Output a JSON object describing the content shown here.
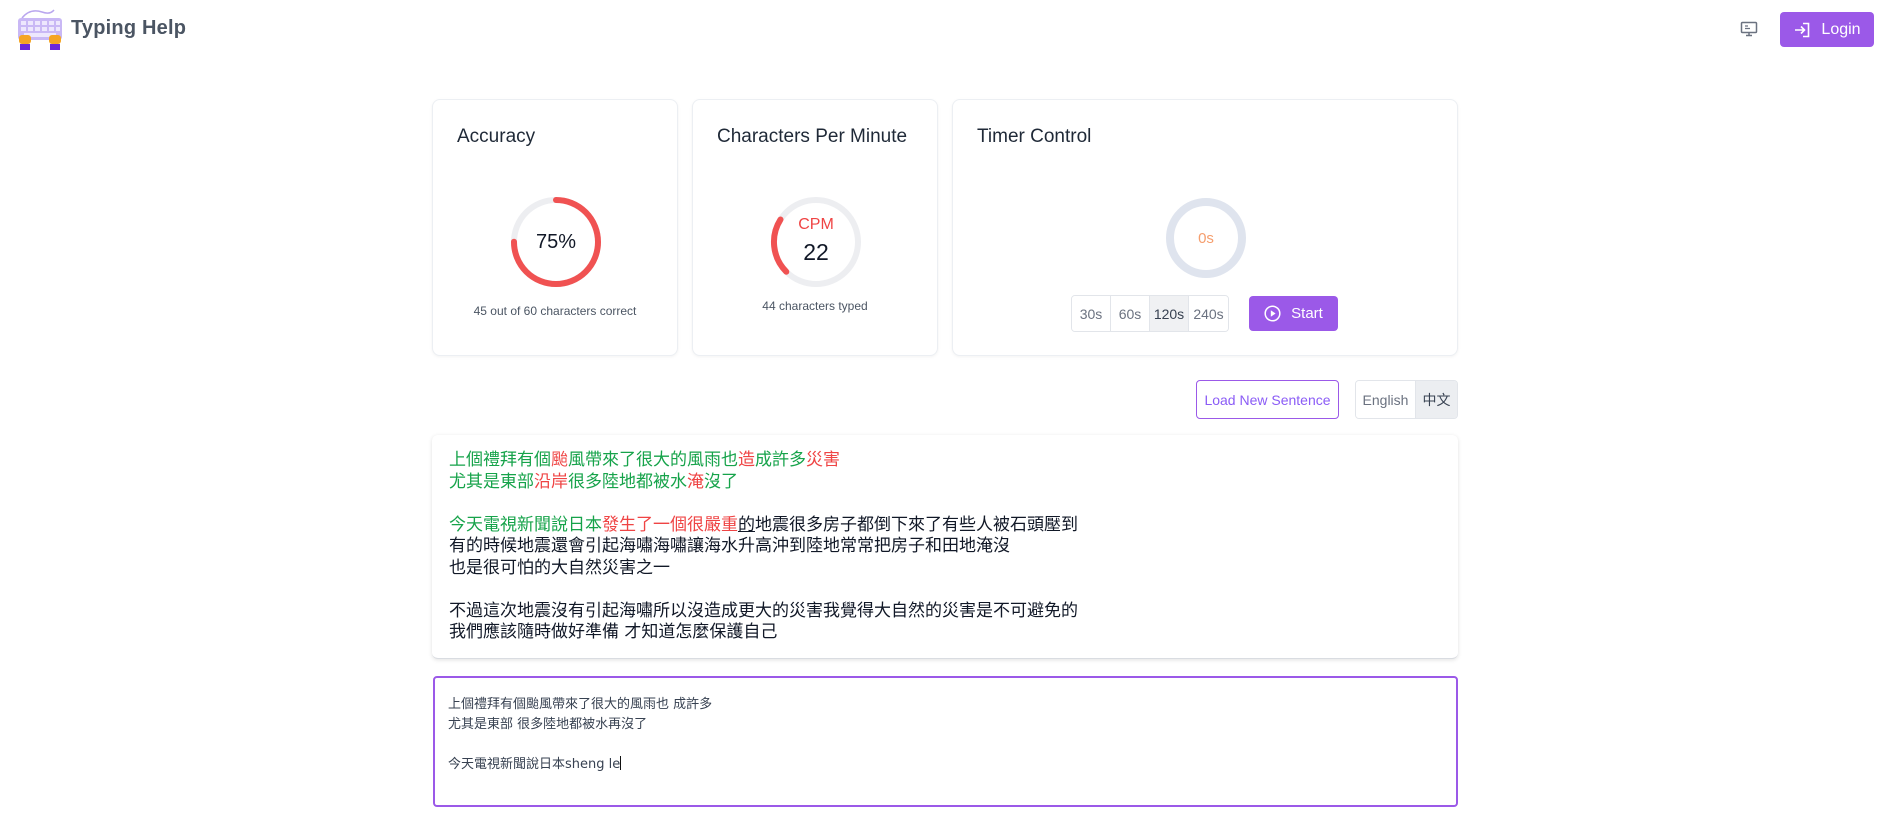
{
  "header": {
    "brand": "Typing Help",
    "login_label": "Login"
  },
  "colors": {
    "accent": "#9b59e8",
    "correct": "#16a34a",
    "incorrect": "#ef4444",
    "timer": "#f59e6e"
  },
  "accuracy": {
    "title": "Accuracy",
    "value": "75%",
    "percent": 75,
    "summary": "45 out of 60 characters correct"
  },
  "cpm": {
    "title": "Characters Per Minute",
    "label": "CPM",
    "value": "22",
    "summary": "44 characters typed"
  },
  "timer": {
    "title": "Timer Control",
    "value": "0s",
    "durations": [
      "30s",
      "60s",
      "120s",
      "240s"
    ],
    "selected": "120s",
    "start_label": "Start"
  },
  "controls": {
    "load_label": "Load New Sentence",
    "lang_en": "English",
    "lang_zh": "中文",
    "selected_lang": "中文"
  },
  "text_segments": [
    [
      [
        "c",
        "上個禮拜有個"
      ],
      [
        "w",
        "颱"
      ],
      [
        "c",
        "風帶來了很大的風雨也"
      ],
      [
        "w",
        "造"
      ],
      [
        "c",
        "成許多"
      ],
      [
        "w",
        "災害"
      ]
    ],
    [
      [
        "c",
        "尤其是東部"
      ],
      [
        "w",
        "沿岸"
      ],
      [
        "c",
        "很多陸地都被水"
      ],
      [
        "w",
        "淹"
      ],
      [
        "c",
        "沒了"
      ]
    ],
    [],
    [
      [
        "c",
        "今天電視新聞說日本"
      ],
      [
        "w",
        "發生了一個很嚴重"
      ],
      [
        "u",
        "的"
      ],
      [
        "n",
        "地震很多房子都倒下來了有些人被石頭壓到"
      ]
    ],
    [
      [
        "n",
        "有的時候地震還會引起海嘯海嘯讓海水升高沖到陸地常常把房子和田地淹沒"
      ]
    ],
    [
      [
        "n",
        "也是很可怕的大自然災害之一"
      ]
    ],
    [],
    [
      [
        "n",
        "不過這次地震沒有引起海嘯所以沒造成更大的災害我覺得大自然的災害是不可避免的"
      ]
    ],
    [
      [
        "n",
        "我們應該隨時做好準備 才知道怎麼保護自己"
      ]
    ]
  ],
  "input_lines": [
    "上個禮拜有個颱風帶來了很大的風雨也 成許多",
    "尤其是東部 很多陸地都被水再沒了",
    "",
    "今天電視新聞說日本sheng le"
  ]
}
